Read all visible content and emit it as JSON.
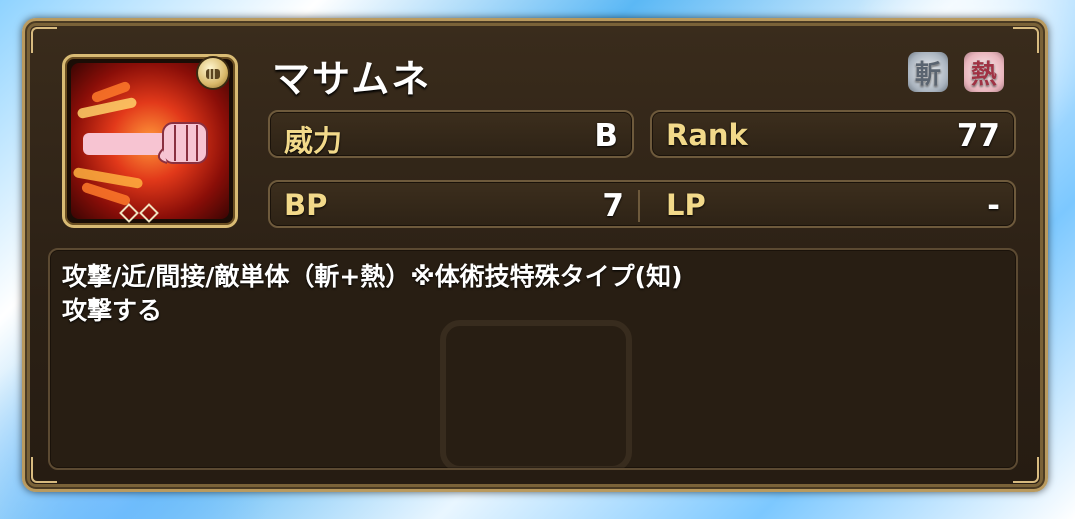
{
  "skill": {
    "name": "マサムネ",
    "icon": "fist-flame-icon",
    "weapon_type_icon": "fist-weapon-icon",
    "rank_diamonds": 2
  },
  "attributes": [
    {
      "label": "斬",
      "icon": "slash-attribute-icon",
      "color": "#aab4bf"
    },
    {
      "label": "熱",
      "icon": "heat-attribute-icon",
      "color": "#e8b4bc"
    }
  ],
  "stats": {
    "power": {
      "label": "威力",
      "value": "B"
    },
    "rank": {
      "label": "Rank",
      "value": "77"
    },
    "bp": {
      "label": "BP",
      "value": "7"
    },
    "lp": {
      "label": "LP",
      "value": "-"
    }
  },
  "description": "攻撃/近/間接/敵単体（斬+熱）※体術技特殊タイプ(知)\n攻撃する",
  "colors": {
    "panel_border": "#b99a5f",
    "label_gold": "#f2d98a",
    "panel_bg": "#2b2015"
  }
}
